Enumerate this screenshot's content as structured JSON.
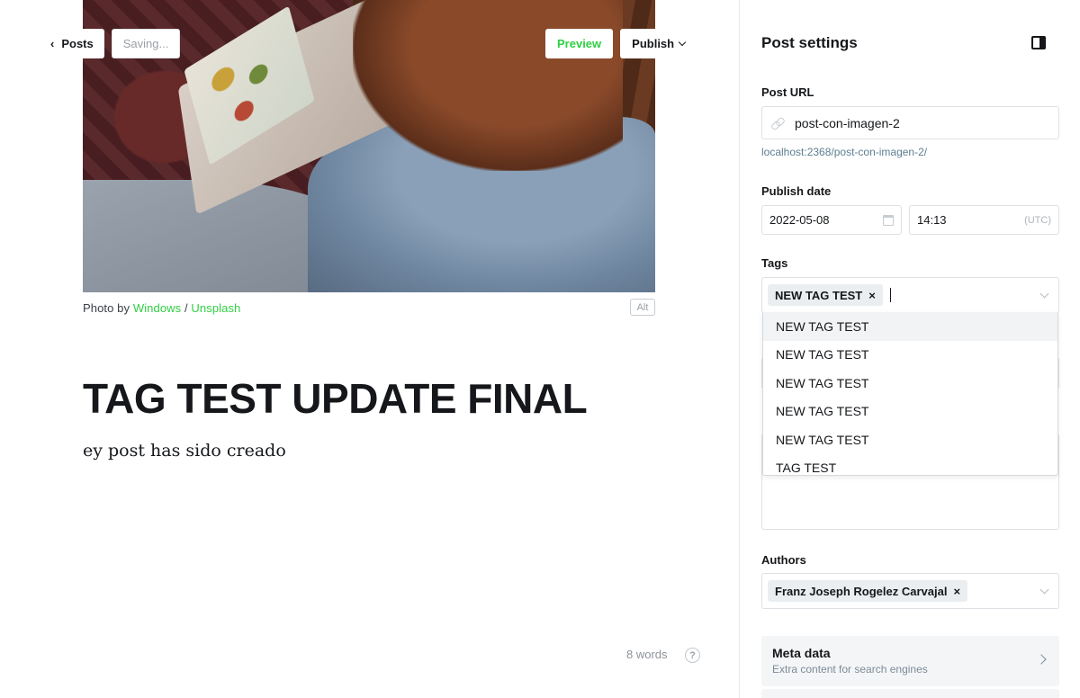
{
  "header": {
    "back_label": "Posts",
    "status_label": "Saving...",
    "preview_label": "Preview",
    "publish_label": "Publish"
  },
  "feature_image": {
    "caption_prefix": "Photo by ",
    "author_link": "Windows",
    "separator": " / ",
    "source_link": "Unsplash",
    "alt_label": "Alt"
  },
  "post": {
    "title": "TAG TEST UPDATE FINAL",
    "body": "ey post has sido creado",
    "word_count": "8 words",
    "help_glyph": "?"
  },
  "settings": {
    "title": "Post settings",
    "post_url": {
      "label": "Post URL",
      "value": "post-con-imagen-2",
      "hint": "localhost:2368/post-con-imagen-2/"
    },
    "publish_date": {
      "label": "Publish date",
      "date": "2022-05-08",
      "time": "14:13",
      "timezone": "(UTC)"
    },
    "tags": {
      "label": "Tags",
      "selected": [
        "NEW TAG TEST"
      ],
      "remove_glyph": "×",
      "options": [
        "NEW TAG TEST",
        "NEW TAG TEST",
        "NEW TAG TEST",
        "NEW TAG TEST",
        "NEW TAG TEST",
        "TAG TEST"
      ]
    },
    "authors": {
      "label": "Authors",
      "selected": [
        "Franz Joseph Rogelez Carvajal"
      ],
      "remove_glyph": "×"
    },
    "meta_data": {
      "title": "Meta data",
      "subtitle": "Extra content for search engines"
    }
  },
  "colors": {
    "accent_green": "#30cf43",
    "url_hint": "#5d7e92"
  }
}
